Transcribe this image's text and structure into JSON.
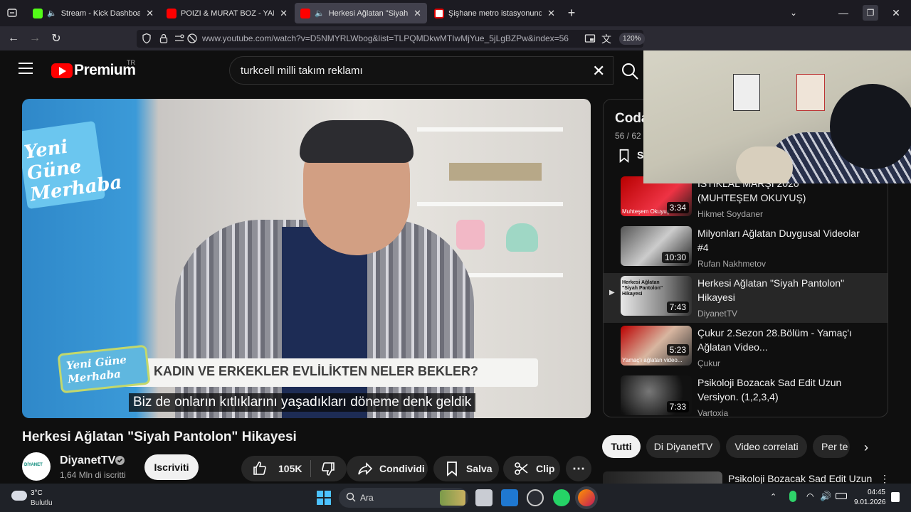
{
  "tabs": [
    {
      "title": "Stream - Kick Dashboard",
      "close": "✕"
    },
    {
      "title": "POIZI & MURAT BOZ - YAPAR M",
      "close": "✕"
    },
    {
      "title": "Herkesi Ağlatan \"Siyah Pant",
      "close": "✕"
    },
    {
      "title": "Şişhane metro istasyonunda intı",
      "close": "✕"
    }
  ],
  "browser": {
    "url": "www.youtube.com/watch?v=D5NMYRLWbog&list=TLPQMDkwMTIwMjYue_5jLgBZPw&index=56",
    "zoom": "120%",
    "new_tab": "+"
  },
  "youtube": {
    "logo_text": "Premium",
    "logo_region": "TR",
    "search_value": "turkcell milli takım reklamı",
    "video": {
      "studio_sign": "Yeni Güne Merhaba",
      "lower_third_logo": "Yeni Güne Merhaba",
      "lower_third_text": "KADIN VE ERKEKLER EVLİLİKTEN NELER BEKLER?",
      "subtitle": "Biz de onların kıtlıklarını yaşadıkları döneme denk geldik"
    },
    "title": "Herkesi Ağlatan \"Siyah Pantolon\" Hikayesi",
    "channel": {
      "name": "DiyanetTV",
      "subs": "1,64 Mln di iscritti",
      "avatar_text": "DİYANET"
    },
    "subscribe": "Iscriviti",
    "likes": "105K",
    "share": "Condividi",
    "save": "Salva",
    "clip": "Clip",
    "playlist": {
      "title": "Coda",
      "position": "56 / 62",
      "save_initial": "S",
      "items": [
        {
          "title": "İSTİKLAL MARŞI 2020 (MUHTEŞEM OKUYUŞ)",
          "channel": "Hikmet Soydaner",
          "duration": "3:34",
          "thumb_text": "Muhteşem Okuyuş"
        },
        {
          "title": "Milyonları Ağlatan Duygusal Videolar #4",
          "channel": "Rufan Nakhmetov",
          "duration": "10:30",
          "thumb_text": ""
        },
        {
          "title": "Herkesi Ağlatan \"Siyah Pantolon\" Hikayesi",
          "channel": "DiyanetTV",
          "duration": "7:43",
          "thumb_text": "Herkesi Ağlatan \"Siyah Pantolon\" Hikayesi",
          "current": true
        },
        {
          "title": "Çukur 2.Sezon 28.Bölüm - Yamaç'ı Ağlatan Video...",
          "channel": "Çukur",
          "duration": "5:23",
          "thumb_text": "Yamaç'ı ağlatan video..."
        },
        {
          "title": "Psikoloji Bozacak Sad Edit Uzun Versiyon. (1,2,3,4)",
          "channel": "Vartoxia",
          "duration": "7:33",
          "thumb_text": ""
        }
      ]
    },
    "chips": [
      "Tutti",
      "Di DiyanetTV",
      "Video correlati",
      "Per te"
    ],
    "next_item": "Psikoloji Bozacak Sad Edit Uzun"
  },
  "taskbar": {
    "weather_temp": "3°C",
    "weather_desc": "Bulutlu",
    "search": "Ara",
    "time": "04:45",
    "date": "9.01.2026"
  },
  "colors": {
    "accent_red": "#ff0000",
    "bg": "#0f0f0f",
    "chip_active_bg": "#f1f1f1"
  }
}
